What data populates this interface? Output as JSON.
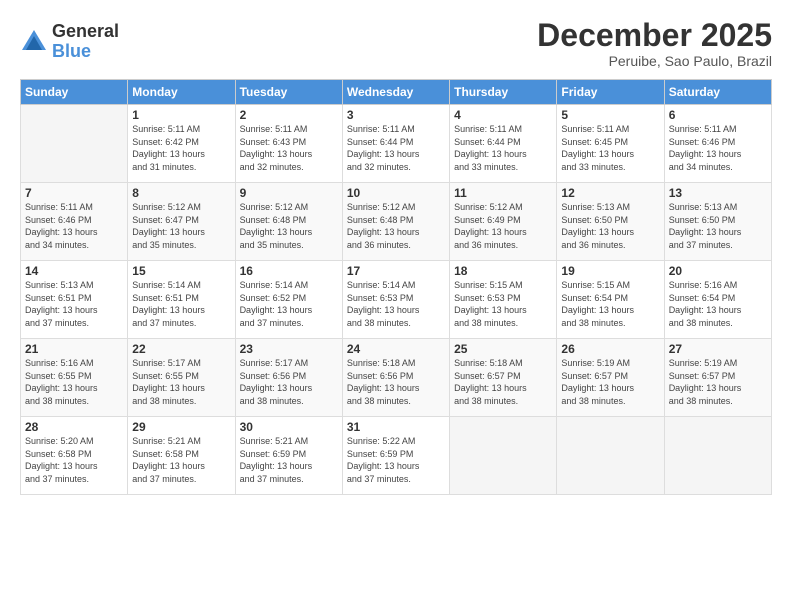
{
  "logo": {
    "general": "General",
    "blue": "Blue"
  },
  "header": {
    "month": "December 2025",
    "location": "Peruibe, Sao Paulo, Brazil"
  },
  "weekdays": [
    "Sunday",
    "Monday",
    "Tuesday",
    "Wednesday",
    "Thursday",
    "Friday",
    "Saturday"
  ],
  "weeks": [
    [
      {
        "day": "",
        "info": ""
      },
      {
        "day": "1",
        "info": "Sunrise: 5:11 AM\nSunset: 6:42 PM\nDaylight: 13 hours\nand 31 minutes."
      },
      {
        "day": "2",
        "info": "Sunrise: 5:11 AM\nSunset: 6:43 PM\nDaylight: 13 hours\nand 32 minutes."
      },
      {
        "day": "3",
        "info": "Sunrise: 5:11 AM\nSunset: 6:44 PM\nDaylight: 13 hours\nand 32 minutes."
      },
      {
        "day": "4",
        "info": "Sunrise: 5:11 AM\nSunset: 6:44 PM\nDaylight: 13 hours\nand 33 minutes."
      },
      {
        "day": "5",
        "info": "Sunrise: 5:11 AM\nSunset: 6:45 PM\nDaylight: 13 hours\nand 33 minutes."
      },
      {
        "day": "6",
        "info": "Sunrise: 5:11 AM\nSunset: 6:46 PM\nDaylight: 13 hours\nand 34 minutes."
      }
    ],
    [
      {
        "day": "7",
        "info": "Sunrise: 5:11 AM\nSunset: 6:46 PM\nDaylight: 13 hours\nand 34 minutes."
      },
      {
        "day": "8",
        "info": "Sunrise: 5:12 AM\nSunset: 6:47 PM\nDaylight: 13 hours\nand 35 minutes."
      },
      {
        "day": "9",
        "info": "Sunrise: 5:12 AM\nSunset: 6:48 PM\nDaylight: 13 hours\nand 35 minutes."
      },
      {
        "day": "10",
        "info": "Sunrise: 5:12 AM\nSunset: 6:48 PM\nDaylight: 13 hours\nand 36 minutes."
      },
      {
        "day": "11",
        "info": "Sunrise: 5:12 AM\nSunset: 6:49 PM\nDaylight: 13 hours\nand 36 minutes."
      },
      {
        "day": "12",
        "info": "Sunrise: 5:13 AM\nSunset: 6:50 PM\nDaylight: 13 hours\nand 36 minutes."
      },
      {
        "day": "13",
        "info": "Sunrise: 5:13 AM\nSunset: 6:50 PM\nDaylight: 13 hours\nand 37 minutes."
      }
    ],
    [
      {
        "day": "14",
        "info": "Sunrise: 5:13 AM\nSunset: 6:51 PM\nDaylight: 13 hours\nand 37 minutes."
      },
      {
        "day": "15",
        "info": "Sunrise: 5:14 AM\nSunset: 6:51 PM\nDaylight: 13 hours\nand 37 minutes."
      },
      {
        "day": "16",
        "info": "Sunrise: 5:14 AM\nSunset: 6:52 PM\nDaylight: 13 hours\nand 37 minutes."
      },
      {
        "day": "17",
        "info": "Sunrise: 5:14 AM\nSunset: 6:53 PM\nDaylight: 13 hours\nand 38 minutes."
      },
      {
        "day": "18",
        "info": "Sunrise: 5:15 AM\nSunset: 6:53 PM\nDaylight: 13 hours\nand 38 minutes."
      },
      {
        "day": "19",
        "info": "Sunrise: 5:15 AM\nSunset: 6:54 PM\nDaylight: 13 hours\nand 38 minutes."
      },
      {
        "day": "20",
        "info": "Sunrise: 5:16 AM\nSunset: 6:54 PM\nDaylight: 13 hours\nand 38 minutes."
      }
    ],
    [
      {
        "day": "21",
        "info": "Sunrise: 5:16 AM\nSunset: 6:55 PM\nDaylight: 13 hours\nand 38 minutes."
      },
      {
        "day": "22",
        "info": "Sunrise: 5:17 AM\nSunset: 6:55 PM\nDaylight: 13 hours\nand 38 minutes."
      },
      {
        "day": "23",
        "info": "Sunrise: 5:17 AM\nSunset: 6:56 PM\nDaylight: 13 hours\nand 38 minutes."
      },
      {
        "day": "24",
        "info": "Sunrise: 5:18 AM\nSunset: 6:56 PM\nDaylight: 13 hours\nand 38 minutes."
      },
      {
        "day": "25",
        "info": "Sunrise: 5:18 AM\nSunset: 6:57 PM\nDaylight: 13 hours\nand 38 minutes."
      },
      {
        "day": "26",
        "info": "Sunrise: 5:19 AM\nSunset: 6:57 PM\nDaylight: 13 hours\nand 38 minutes."
      },
      {
        "day": "27",
        "info": "Sunrise: 5:19 AM\nSunset: 6:57 PM\nDaylight: 13 hours\nand 38 minutes."
      }
    ],
    [
      {
        "day": "28",
        "info": "Sunrise: 5:20 AM\nSunset: 6:58 PM\nDaylight: 13 hours\nand 37 minutes."
      },
      {
        "day": "29",
        "info": "Sunrise: 5:21 AM\nSunset: 6:58 PM\nDaylight: 13 hours\nand 37 minutes."
      },
      {
        "day": "30",
        "info": "Sunrise: 5:21 AM\nSunset: 6:59 PM\nDaylight: 13 hours\nand 37 minutes."
      },
      {
        "day": "31",
        "info": "Sunrise: 5:22 AM\nSunset: 6:59 PM\nDaylight: 13 hours\nand 37 minutes."
      },
      {
        "day": "",
        "info": ""
      },
      {
        "day": "",
        "info": ""
      },
      {
        "day": "",
        "info": ""
      }
    ]
  ]
}
